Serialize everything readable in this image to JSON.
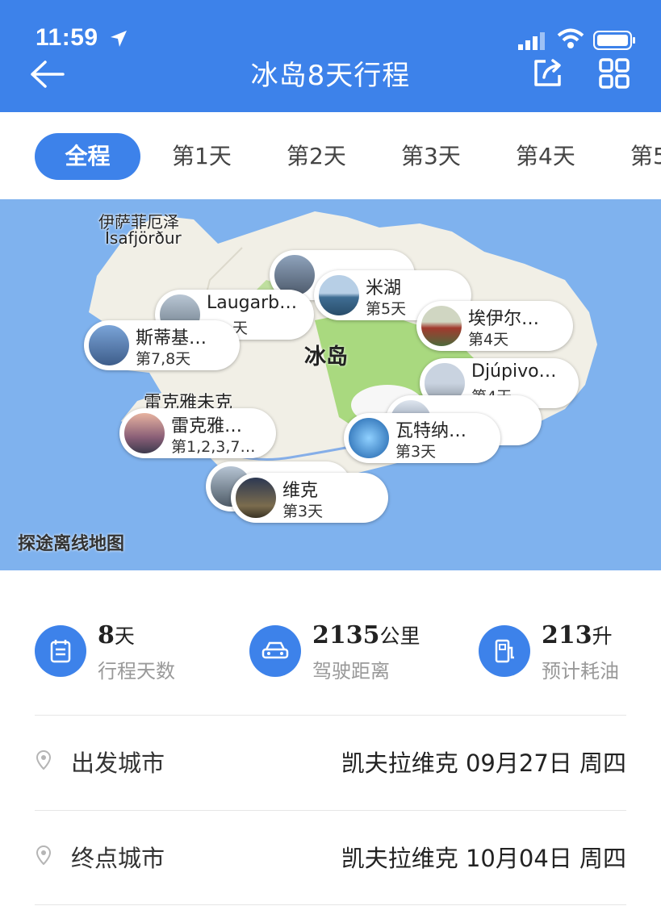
{
  "status_bar": {
    "time": "11:59"
  },
  "header": {
    "title": "冰岛8天行程"
  },
  "tabs": [
    {
      "label": "全程",
      "active": true
    },
    {
      "label": "第1天"
    },
    {
      "label": "第2天"
    },
    {
      "label": "第3天"
    },
    {
      "label": "第4天"
    },
    {
      "label": "第5"
    }
  ],
  "map": {
    "center_label": "冰岛",
    "attribution": "探途离线地图",
    "place_labels": {
      "isafjordur_cn": "伊萨菲厄泽",
      "isafjordur": "Ísafjörður",
      "reykjavik": "雷克雅未克"
    },
    "pins": [
      {
        "name": "米湖",
        "days": "第5天"
      },
      {
        "name": "Laugarb…",
        "days": "天"
      },
      {
        "name": "斯蒂基…",
        "days": "第7,8天"
      },
      {
        "name": "埃伊尔…",
        "days": "第4天"
      },
      {
        "name": "Djúpivo…",
        "days": "第4天"
      },
      {
        "name": "雷克雅…",
        "days": "第1,2,3,7…"
      },
      {
        "name": "瓦特纳…",
        "days": "第3天"
      },
      {
        "name": "维克",
        "days": "第3天"
      }
    ]
  },
  "stats": [
    {
      "value": "8",
      "unit": "天",
      "label": "行程天数",
      "icon": "calendar-icon"
    },
    {
      "value": "2135",
      "unit": "公里",
      "label": "驾驶距离",
      "icon": "car-icon"
    },
    {
      "value": "213",
      "unit": "升",
      "label": "预计耗油",
      "icon": "fuel-pump-icon"
    }
  ],
  "departure": {
    "label": "出发城市",
    "value": "凯夫拉维克 09月27日 周四"
  },
  "arrival": {
    "label": "终点城市",
    "value": "凯夫拉维克 10月04日 周四"
  },
  "colors": {
    "primary": "#3d82ea",
    "sea": "#7fb2ee",
    "land": "#f1efe6",
    "green": "#a9d97f"
  }
}
